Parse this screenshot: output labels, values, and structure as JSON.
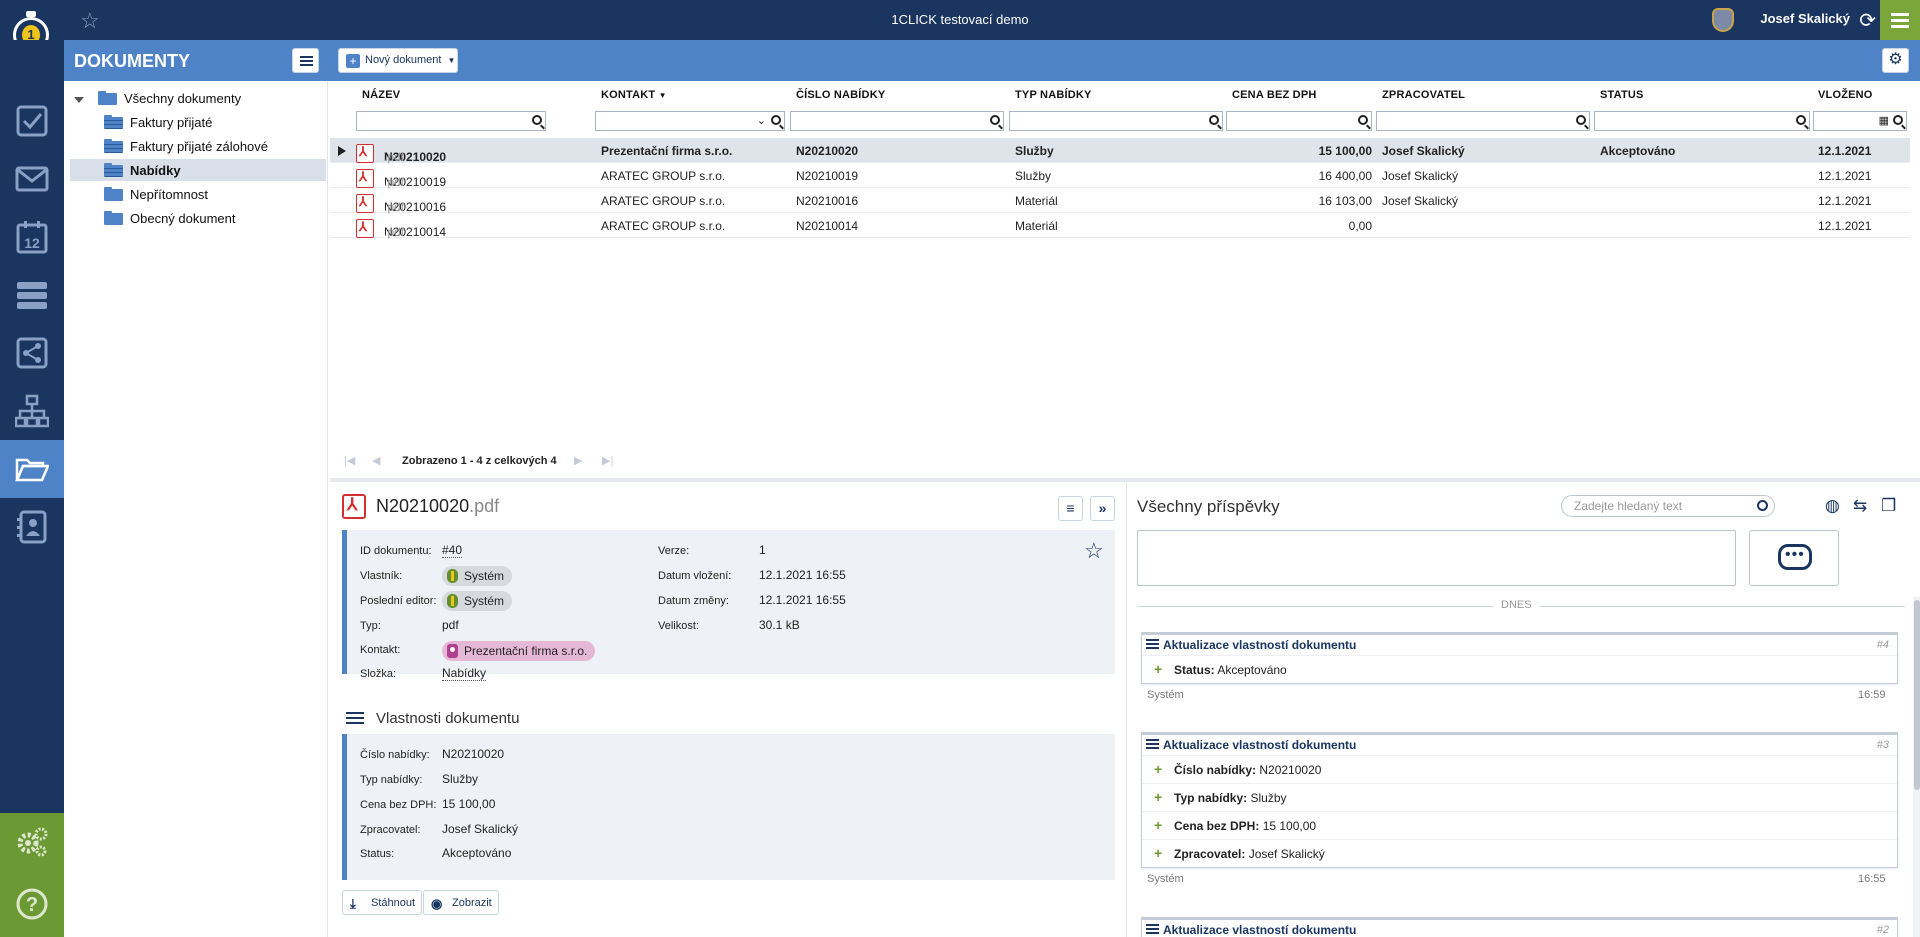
{
  "app": {
    "title": "1CLICK testovací demo",
    "user": "Josef Skalický",
    "logo_digit": "1"
  },
  "header": {
    "section_title": "DOKUMENTY",
    "new_document_label": "Nový dokument"
  },
  "rail": {
    "items": [
      "tasks-icon",
      "mail-icon",
      "calendar-icon",
      "database-icon",
      "share-icon",
      "org-chart-icon",
      "folder-open-icon",
      "contact-card-icon"
    ],
    "calendar_day": "12",
    "bottom": [
      "settings-icon",
      "help-icon"
    ],
    "bottom_help_glyph": "?"
  },
  "tree": {
    "root": "Všechny dokumenty",
    "items": [
      "Faktury přijaté",
      "Faktury přijaté zálohové",
      "Nabídky",
      "Nepřítomnost",
      "Obecný dokument"
    ],
    "selected": "Nabídky"
  },
  "grid": {
    "columns": [
      "NÁZEV",
      "KONTAKT",
      "ČÍSLO NABÍDKY",
      "TYP NABÍDKY",
      "CENA BEZ DPH",
      "ZPRACOVATEL",
      "STATUS",
      "VLOŽENO"
    ],
    "rows": [
      {
        "name": "N20210020",
        "ext": ".pdf",
        "contact": "Prezentační firma s.r.o.",
        "number": "N20210020",
        "type": "Služby",
        "price": "15 100,00",
        "handler": "Josef Skalický",
        "status": "Akceptováno",
        "inserted": "12.1.2021"
      },
      {
        "name": "N20210019",
        "ext": ".pdf",
        "contact": "ARATEC GROUP s.r.o.",
        "number": "N20210019",
        "type": "Služby",
        "price": "16 400,00",
        "handler": "Josef Skalický",
        "status": "",
        "inserted": "12.1.2021"
      },
      {
        "name": "N20210016",
        "ext": ".pdf",
        "contact": "ARATEC GROUP s.r.o.",
        "number": "N20210016",
        "type": "Materiál",
        "price": "16 103,00",
        "handler": "Josef Skalický",
        "status": "",
        "inserted": "12.1.2021"
      },
      {
        "name": "N20210014",
        "ext": ".pdf",
        "contact": "ARATEC GROUP s.r.o.",
        "number": "N20210014",
        "type": "Materiál",
        "price": "0,00",
        "handler": "",
        "status": "",
        "inserted": "12.1.2021"
      }
    ],
    "pager_text": "Zobrazeno 1 - 4 z celkových 4"
  },
  "detail": {
    "name": "N20210020",
    "ext": ".pdf",
    "fields_left": [
      {
        "label": "ID dokumentu:",
        "value": "#40"
      },
      {
        "label": "Vlastník:",
        "value": "Systém"
      },
      {
        "label": "Poslední editor:",
        "value": "Systém"
      },
      {
        "label": "Typ:",
        "value": "pdf"
      },
      {
        "label": "Kontakt:",
        "value": "Prezentační firma s.r.o."
      },
      {
        "label": "Složka:",
        "value": "Nabídky"
      }
    ],
    "fields_right": [
      {
        "label": "Verze:",
        "value": "1"
      },
      {
        "label": "Datum vložení:",
        "value": "12.1.2021 16:55"
      },
      {
        "label": "Datum změny:",
        "value": "12.1.2021 16:55"
      },
      {
        "label": "Velikost:",
        "value": "30.1 kB"
      }
    ],
    "properties_heading": "Vlastnosti dokumentu",
    "properties": [
      {
        "label": "Číslo nabídky:",
        "value": "N20210020"
      },
      {
        "label": "Typ nabídky:",
        "value": "Služby"
      },
      {
        "label": "Cena bez DPH:",
        "value": "15 100,00"
      },
      {
        "label": "Zpracovatel:",
        "value": "Josef Skalický"
      },
      {
        "label": "Status:",
        "value": "Akceptováno"
      }
    ],
    "download_label": "Stáhnout",
    "view_label": "Zobrazit"
  },
  "comments": {
    "title": "Všechny příspěvky",
    "search_placeholder": "Zadejte hledaný text",
    "day_label": "DNES",
    "cards": [
      {
        "title": "Aktualizace vlastností dokumentu",
        "num": "#4",
        "lines": [
          {
            "key": "Status:",
            "val": "Akceptováno"
          }
        ],
        "author": "Systém",
        "time": "16:59"
      },
      {
        "title": "Aktualizace vlastností dokumentu",
        "num": "#3",
        "lines": [
          {
            "key": "Číslo nabídky:",
            "val": "N20210020"
          },
          {
            "key": "Typ nabídky:",
            "val": "Služby"
          },
          {
            "key": "Cena bez DPH:",
            "val": "15 100,00"
          },
          {
            "key": "Zpracovatel:",
            "val": "Josef Skalický"
          }
        ],
        "author": "Systém",
        "time": "16:55"
      },
      {
        "title": "Aktualizace vlastností dokumentu",
        "num": "#2",
        "lines": [],
        "author": "",
        "time": ""
      }
    ]
  },
  "colors": {
    "navy": "#1a3560",
    "accent": "#4f83c7",
    "green": "#7aa63a",
    "pdf_red": "#d32f2f"
  }
}
